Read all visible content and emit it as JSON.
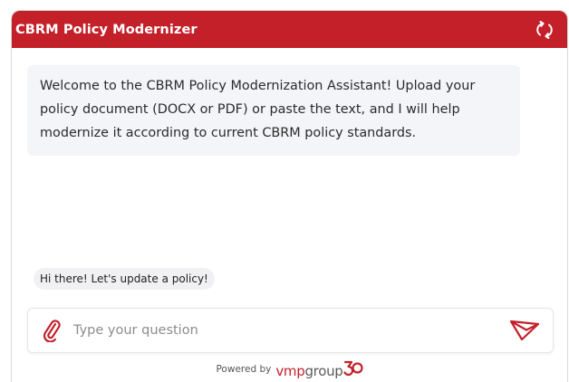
{
  "header": {
    "title": "CBRM Policy Modernizer",
    "refresh_icon": "refresh-icon",
    "color": "#c4202a"
  },
  "messages": {
    "welcome": "Welcome to the CBRM Policy Modernization Assistant! Upload your policy document (DOCX or PDF) or paste the text, and I will help modernize it according to current CBRM policy standards."
  },
  "suggestions": [
    {
      "label": "Hi there! Let's update a policy!"
    }
  ],
  "input": {
    "placeholder": "Type your question",
    "value": "",
    "attach_icon": "paperclip-icon",
    "send_icon": "paper-plane-icon"
  },
  "footer": {
    "powered_by": "Powered by",
    "brand_part1": "vmp",
    "brand_part2": "group"
  }
}
